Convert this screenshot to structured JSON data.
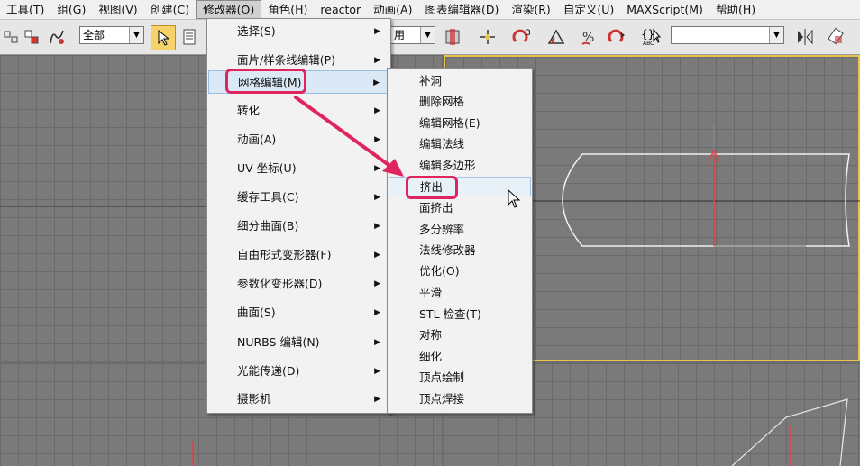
{
  "menubar": {
    "items": [
      {
        "label": "工具(T)"
      },
      {
        "label": "组(G)"
      },
      {
        "label": "视图(V)"
      },
      {
        "label": "创建(C)"
      },
      {
        "label": "修改器(O)"
      },
      {
        "label": "角色(H)"
      },
      {
        "label": "reactor"
      },
      {
        "label": "动画(A)"
      },
      {
        "label": "图表编辑器(D)"
      },
      {
        "label": "渲染(R)"
      },
      {
        "label": "自定义(U)"
      },
      {
        "label": "MAXScript(M)"
      },
      {
        "label": "帮助(H)"
      }
    ],
    "active_index": 4
  },
  "toolbar": {
    "selection_filter": "全部",
    "partial_combo_text": "用",
    "named_selection": ""
  },
  "modifiers_menu": {
    "items": [
      {
        "label": "选择(S)"
      },
      {
        "label": "面片/样条线编辑(P)"
      },
      {
        "label": "网格编辑(M)"
      },
      {
        "label": "转化"
      },
      {
        "label": "动画(A)"
      },
      {
        "label": "UV 坐标(U)"
      },
      {
        "label": "缓存工具(C)"
      },
      {
        "label": "细分曲面(B)"
      },
      {
        "label": "自由形式变形器(F)"
      },
      {
        "label": "参数化变形器(D)"
      },
      {
        "label": "曲面(S)"
      },
      {
        "label": "NURBS 编辑(N)"
      },
      {
        "label": "光能传递(D)"
      },
      {
        "label": "摄影机"
      }
    ],
    "highlighted_index": 2
  },
  "mesh_editing_submenu": {
    "items": [
      {
        "label": "补洞"
      },
      {
        "label": "删除网格"
      },
      {
        "label": "编辑网格(E)"
      },
      {
        "label": "编辑法线"
      },
      {
        "label": "编辑多边形"
      },
      {
        "label": "挤出"
      },
      {
        "label": "面挤出"
      },
      {
        "label": "多分辨率"
      },
      {
        "label": "法线修改器"
      },
      {
        "label": "优化(O)"
      },
      {
        "label": "平滑"
      },
      {
        "label": "STL 检查(T)"
      },
      {
        "label": "对称"
      },
      {
        "label": "细化"
      },
      {
        "label": "顶点绘制"
      },
      {
        "label": "顶点焊接"
      }
    ],
    "highlighted_index": 5
  },
  "colors": {
    "annotation": "#e0245e",
    "active_viewport_border": "#e9c44a",
    "menu_highlight": "#dbe8f6"
  }
}
